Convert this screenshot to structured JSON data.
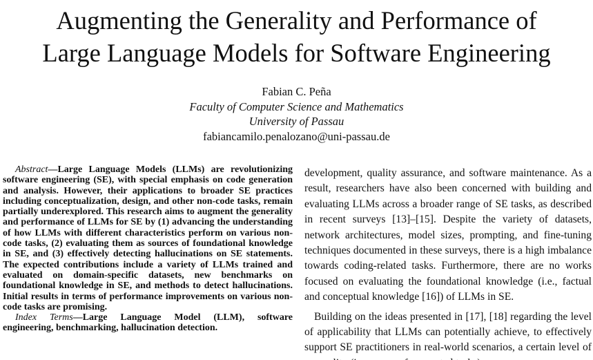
{
  "title": {
    "line1": "Augmenting the Generality and Performance of",
    "line2": "Large Language Models for Software Engineering"
  },
  "author": {
    "name": "Fabian C. Peña",
    "department": "Faculty of Computer Science and Mathematics",
    "university": "University of Passau",
    "email": "fabiancamilo.penalozano@uni-passau.de"
  },
  "abstract": {
    "label": "Abstract",
    "text": "—Large Language Models (LLMs) are revolutionizing software engineering (SE), with special emphasis on code generation and analysis. However, their applications to broader SE practices including conceptualization, design, and other non-code tasks, remain partially underexplored. This research aims to augment the generality and performance of LLMs for SE by (1) advancing the understanding of how LLMs with different characteristics perform on various non-code tasks, (2) evaluating them as sources of foundational knowledge in SE, and (3) effectively detecting hallucinations on SE statements. The expected contributions include a variety of LLMs trained and evaluated on domain-specific datasets, new benchmarks on foundational knowledge in SE, and methods to detect hallucinations. Initial results in terms of performance improvements on various non-code tasks are promising."
  },
  "index_terms": {
    "label": "Index Terms",
    "text": "—Large Language Model (LLM), software engineering, benchmarking, hallucination detection."
  },
  "right_column": {
    "para1": "development, quality assurance, and software maintenance. As a result, researchers have also been concerned with building and evaluating LLMs across a broader range of SE tasks, as described in recent surveys [13]–[15]. Despite the variety of datasets, network architectures, model sizes, prompting, and fine-tuning techniques documented in these surveys, there is a high imbalance towards coding-related tasks. Furthermore, there are no works focused on evaluating the foundational knowledge (i.e., factual and conceptual knowledge [16]) of LLMs in SE.",
    "para2": "Building on the ideas presented in [17], [18] regarding the level of applicability that LLMs can potentially achieve, to effectively support SE practitioners in real-world scenarios, a certain level of generality (i.e., range of supported tasks)"
  }
}
